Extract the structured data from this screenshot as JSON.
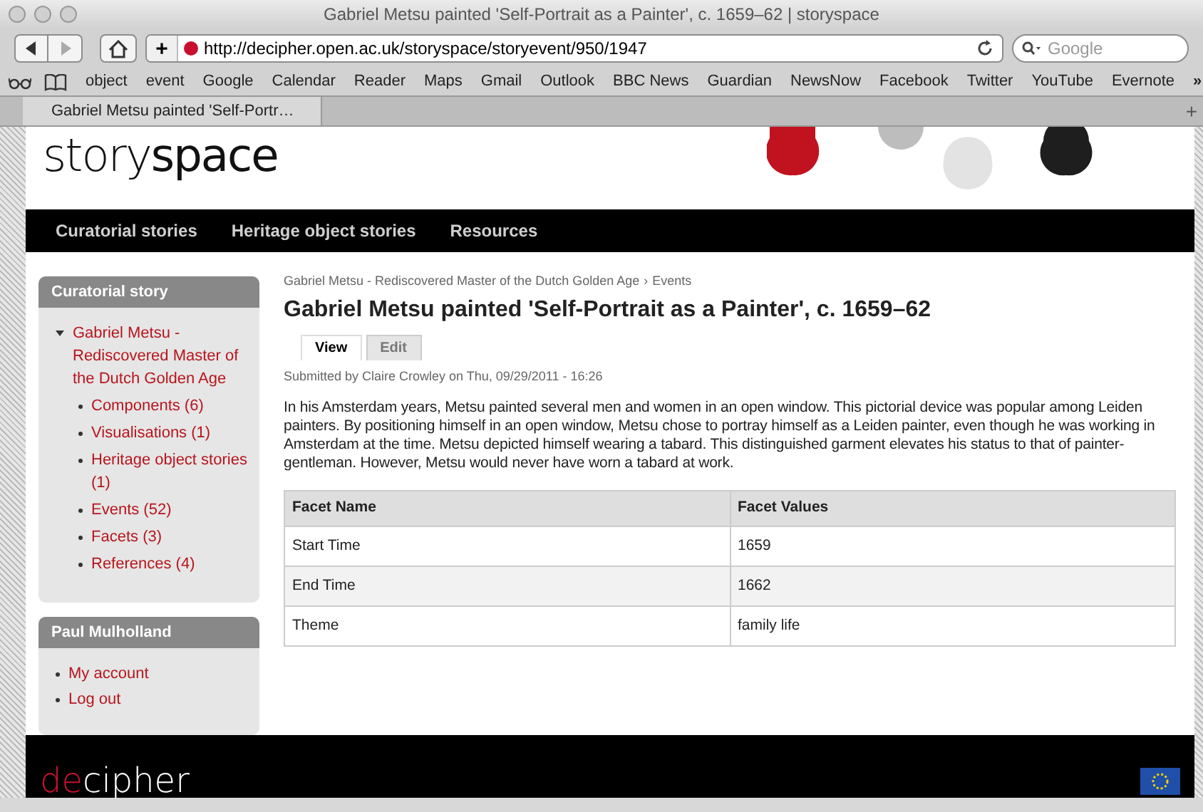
{
  "window": {
    "title": "Gabriel Metsu painted 'Self-Portrait as a Painter', c. 1659–62 | storyspace"
  },
  "toolbar": {
    "url": "http://decipher.open.ac.uk/storyspace/storyevent/950/1947",
    "search_placeholder": "Google",
    "add_label": "+"
  },
  "bookmarks": [
    "object",
    "event",
    "Google",
    "Calendar",
    "Reader",
    "Maps",
    "Gmail",
    "Outlook",
    "BBC News",
    "Guardian",
    "NewsNow",
    "Facebook",
    "Twitter",
    "YouTube",
    "Evernote"
  ],
  "more_bookmarks": "»",
  "tabs": [
    {
      "label": "Gabriel Metsu painted 'Self-Portr…",
      "selected": true
    }
  ],
  "new_tab": "+",
  "site": {
    "logo": "story**space**",
    "nav": [
      "Curatorial stories",
      "Heritage object stories",
      "Resources"
    ]
  },
  "sidebar": {
    "blocks": [
      {
        "title": "Curatorial story",
        "items": [
          {
            "label": "Gabriel Metsu - Rediscovered Master of the Dutch Golden Age",
            "children": [
              {
                "label": "Components (6)"
              },
              {
                "label": "Visualisations (1)"
              },
              {
                "label": "Heritage object stories (1)"
              },
              {
                "label": "Events (52)"
              },
              {
                "label": "Facets (3)"
              },
              {
                "label": "References (4)"
              }
            ]
          }
        ]
      },
      {
        "title": "Paul Mulholland",
        "items": [
          {
            "label": "My account"
          },
          {
            "label": "Log out"
          }
        ]
      }
    ]
  },
  "main": {
    "breadcrumb": [
      "Gabriel Metsu - Rediscovered Master of the Dutch Golden Age",
      "Events"
    ],
    "breadcrumb_separator": "›",
    "title": "Gabriel Metsu painted 'Self-Portrait as a Painter', c. 1659–62",
    "tabs": [
      {
        "label": "View",
        "selected": true
      },
      {
        "label": "Edit",
        "selected": false
      }
    ],
    "submitted": "Submitted by Claire Crowley on Thu, 09/29/2011 - 16:26",
    "body": "In his Amsterdam years, Metsu painted several men and women in an open window. This pictorial device was popular among Leiden painters. By positioning himself in an open window, Metsu chose to portray himself as a Leiden painter, even though he was working in Amsterdam at the time. Metsu depicted himself wearing a tabard. This distinguished garment elevates his status to that of painter-gentleman. However, Metsu would never have worn a tabard at work.",
    "table": {
      "columns": [
        "Facet Name",
        "Facet Values"
      ],
      "rows": [
        [
          "Start Time",
          "1659"
        ],
        [
          "End Time",
          "1662"
        ],
        [
          "Theme",
          "family life"
        ]
      ]
    }
  },
  "footer": {
    "logo_accent": "de",
    "logo_rest": "cipher"
  }
}
